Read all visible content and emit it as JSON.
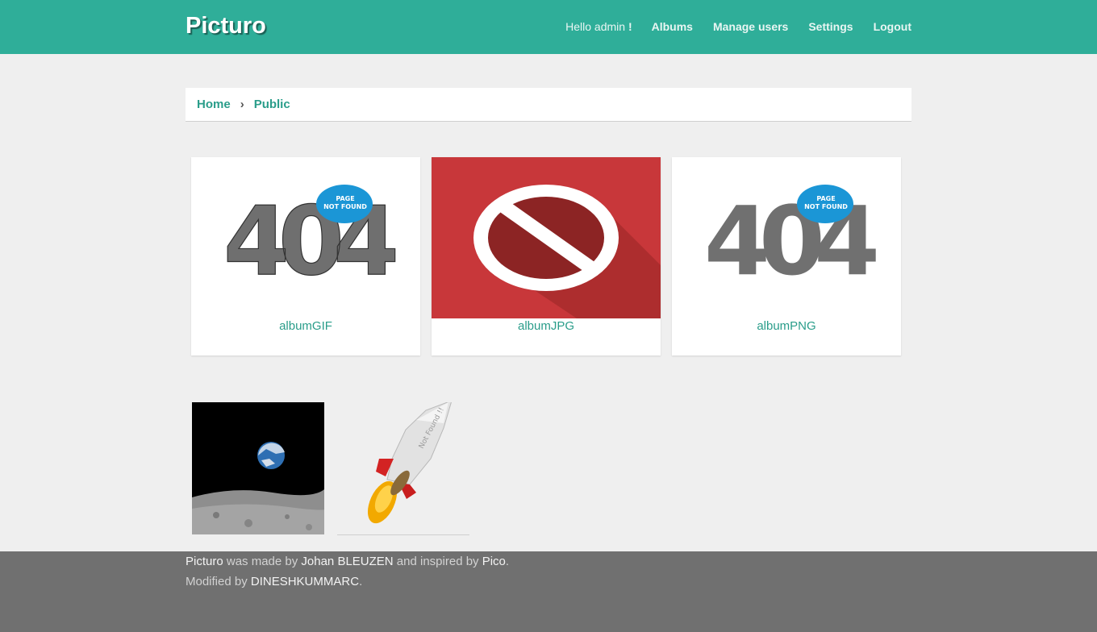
{
  "header": {
    "brand": "Picturo",
    "greeting_prefix": "Hello admin",
    "greeting_suffix": "!",
    "nav": [
      "Albums",
      "Manage users",
      "Settings",
      "Logout"
    ]
  },
  "breadcrumb": {
    "home": "Home",
    "separator": "›",
    "current": "Public"
  },
  "albums": [
    {
      "name": "albumGIF",
      "thumb_icon": "404-page-not-found-image",
      "badge_line1": "PAGE",
      "badge_line2": "NOT FOUND",
      "digits": "404"
    },
    {
      "name": "albumJPG",
      "thumb_icon": "prohibited-sign-image"
    },
    {
      "name": "albumPNG",
      "thumb_icon": "404-page-not-found-image",
      "badge_line1": "PAGE",
      "badge_line2": "NOT FOUND",
      "digits": "404"
    }
  ],
  "photos": [
    {
      "icon": "earthrise-photo"
    },
    {
      "icon": "rocket-not-found-image",
      "label": "Not Found !!"
    }
  ],
  "footer": {
    "line1": {
      "brand": "Picturo",
      "t1": " was made by ",
      "author": "Johan BLEUZEN",
      "t2": " and inspired by ",
      "inspired": "Pico",
      "t3": "."
    },
    "line2": {
      "t1": "Modified by ",
      "modifier": "DINESHKUMMARC",
      "t2": "."
    }
  },
  "colors": {
    "header_bg": "#2fae99",
    "accent_text": "#2a9d8a",
    "page_bg": "#efefef",
    "footer_bg": "#707070",
    "badge_blue": "#1b96d6",
    "stop_red": "#c8373a"
  }
}
